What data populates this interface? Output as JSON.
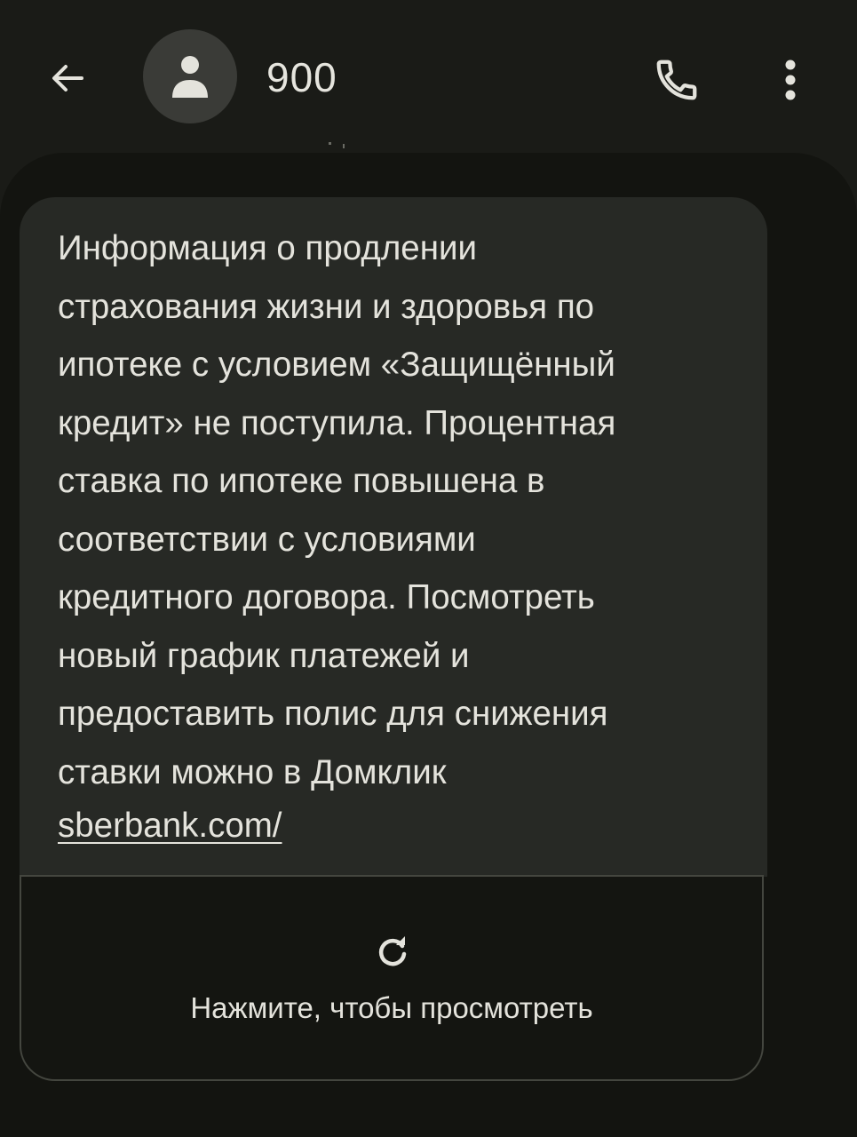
{
  "header": {
    "sender": "900",
    "icons": {
      "back": "arrow-back-icon",
      "avatar": "person-icon",
      "call": "phone-icon",
      "more": "more-vert-icon"
    }
  },
  "message": {
    "text": "Информация о продлении\nстрахования жизни и здоровья по\nипотеке с условием «Защищённый\nкредит» не поступила. Процентная\nставка по ипотеке повышена в\nсоответствии с условиями\nкредитного договора. Посмотреть\nновый график платежей и\nпредоставить полис для снижения\nставки можно в Домклик",
    "link": "sberbank.com/"
  },
  "preview": {
    "label": "Нажмите, чтобы просмотреть",
    "icon": "refresh-icon"
  },
  "colors": {
    "background": "#1a1b17",
    "panel": "#131410",
    "bubble": "#272925",
    "text": "#e4e3dc"
  }
}
